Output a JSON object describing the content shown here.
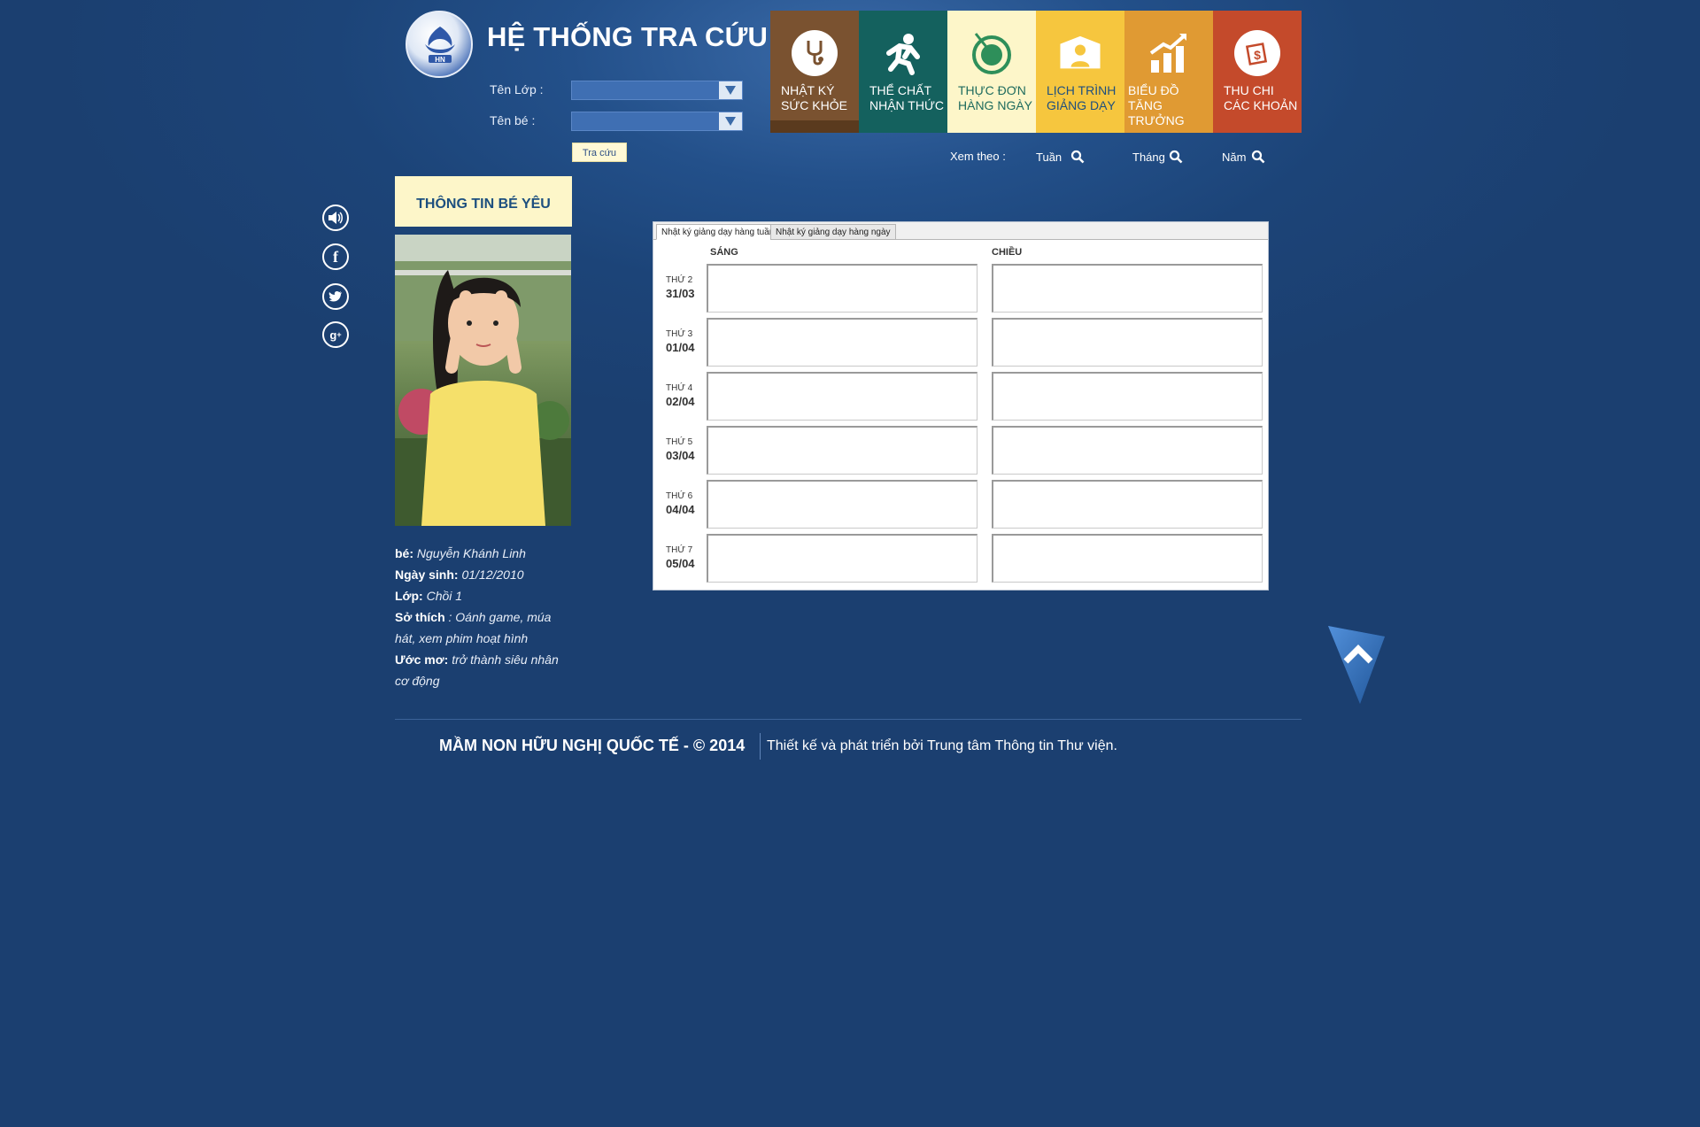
{
  "header": {
    "title": "HỆ THỐNG TRA CỨU",
    "class_label": "Tên Lớp :",
    "child_label": "Tên bé :",
    "search_button": "Tra cứu"
  },
  "nav": [
    {
      "line1": "NHẬT KÝ",
      "line2": "SỨC KHỎE",
      "color": "#7a5230",
      "bar": "#5a3a1e",
      "icon": "stethoscope-icon"
    },
    {
      "line1": "THỂ CHẤT",
      "line2": "NHẬN THỨC",
      "color": "#14615e",
      "bar": "#14615e",
      "icon": "running-person-icon"
    },
    {
      "line1": "THỰC ĐƠN",
      "line2": "HÀNG NGÀY",
      "color": "#fdf6c9",
      "bar": "#fdf6c9",
      "icon": "dish-icon"
    },
    {
      "line1": "LỊCH TRÌNH",
      "line2": "GIẢNG DẠY",
      "color": "#f6c63e",
      "bar": "#f6c63e",
      "icon": "teacher-icon"
    },
    {
      "line1": "BIỂU ĐỒ",
      "line2": "TĂNG TRƯỞNG",
      "color": "#e09a33",
      "bar": "#e09a33",
      "icon": "growth-chart-icon"
    },
    {
      "line1": "THU CHI",
      "line2": "CÁC KHOẢN",
      "color": "#c44a2b",
      "bar": "#c44a2b",
      "icon": "money-icon"
    }
  ],
  "view": {
    "label": "Xem theo :",
    "week": "Tuần",
    "month": "Tháng",
    "year": "Năm"
  },
  "sidebar": {
    "info_title": "THÔNG TIN BÉ YÊU",
    "name_label": "bé:",
    "name": "Nguyễn Khánh Linh",
    "dob_label": "Ngày sinh:",
    "dob": "01/12/2010",
    "class_label": "Lớp:",
    "class": "Chồi 1",
    "hobby_label": "Sở thích",
    "hobby": ": Oánh game, múa hát, xem phim hoạt hình",
    "dream_label": "Ước mơ:",
    "dream": "trở thành siêu nhân cơ động"
  },
  "schedule": {
    "tab_week": "Nhật ký giảng dạy hàng tuần",
    "tab_day": "Nhật ký giảng dạy hàng ngày",
    "morning": "SÁNG",
    "afternoon": "CHIỀU",
    "days": [
      {
        "name": "THỨ 2",
        "date": "31/03"
      },
      {
        "name": "THỨ 3",
        "date": "01/04"
      },
      {
        "name": "THỨ 4",
        "date": "02/04"
      },
      {
        "name": "THỨ 5",
        "date": "03/04"
      },
      {
        "name": "THỨ 6",
        "date": "04/04"
      },
      {
        "name": "THỨ 7",
        "date": "05/04"
      }
    ]
  },
  "footer": {
    "left": "MẦM NON HỮU NGHỊ QUỐC TẾ - © 2014",
    "right": "Thiết kế và phát triển bởi Trung tâm Thông tin Thư viện."
  }
}
